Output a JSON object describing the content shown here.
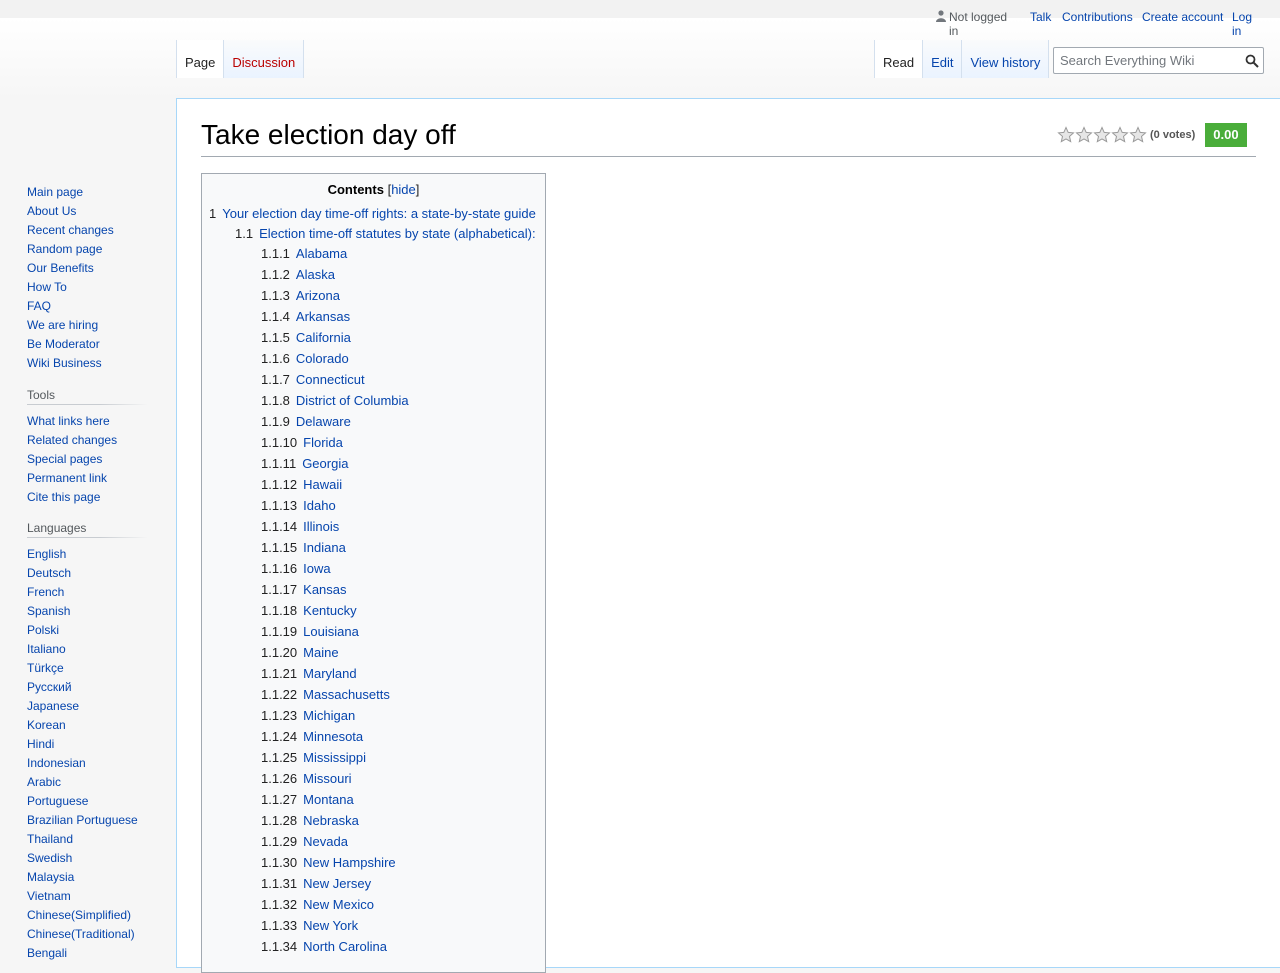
{
  "personal": {
    "user": "Not logged in",
    "talk": "Talk",
    "contributions": "Contributions",
    "create_account": "Create account",
    "login": "Log in"
  },
  "tabs": {
    "page": "Page",
    "discussion": "Discussion",
    "read": "Read",
    "edit": "Edit",
    "history": "View history"
  },
  "search": {
    "placeholder": "Search Everything Wiki"
  },
  "sidebar": {
    "navigation": [
      "Main page",
      "About Us",
      "Recent changes",
      "Random page",
      "Our Benefits",
      "How To",
      "FAQ",
      "We are hiring",
      "Be Moderator",
      "Wiki Business"
    ],
    "tools_title": "Tools",
    "tools": [
      "What links here",
      "Related changes",
      "Special pages",
      "Permanent link",
      "Cite this page"
    ],
    "languages_title": "Languages",
    "languages": [
      "English",
      "Deutsch",
      "French",
      "Spanish",
      "Polski",
      "Italiano",
      "Türkçe",
      "Русский",
      "Japanese",
      "Korean",
      "Hindi",
      "Indonesian",
      "Arabic",
      "Portuguese",
      "Brazilian Portuguese",
      "Thailand",
      "Swedish",
      "Malaysia",
      "Vietnam",
      "Chinese(Simplified)",
      "Chinese(Traditional)",
      "Bengali"
    ]
  },
  "page": {
    "title": "Take election day off",
    "votes": "(0 votes)",
    "score": "0.00",
    "stars": 5
  },
  "toc": {
    "title": "Contents",
    "toggle": "hide",
    "top": [
      {
        "num": "1",
        "text": "Your election day time-off rights: a state-by-state guide"
      },
      {
        "num": "1.1",
        "text": "Election time-off statutes by state (alphabetical):"
      }
    ],
    "states": [
      {
        "num": "1.1.1",
        "text": "Alabama"
      },
      {
        "num": "1.1.2",
        "text": "Alaska"
      },
      {
        "num": "1.1.3",
        "text": "Arizona"
      },
      {
        "num": "1.1.4",
        "text": "Arkansas"
      },
      {
        "num": "1.1.5",
        "text": "California"
      },
      {
        "num": "1.1.6",
        "text": "Colorado"
      },
      {
        "num": "1.1.7",
        "text": "Connecticut"
      },
      {
        "num": "1.1.8",
        "text": "District of Columbia"
      },
      {
        "num": "1.1.9",
        "text": "Delaware"
      },
      {
        "num": "1.1.10",
        "text": "Florida"
      },
      {
        "num": "1.1.11",
        "text": "Georgia"
      },
      {
        "num": "1.1.12",
        "text": "Hawaii"
      },
      {
        "num": "1.1.13",
        "text": "Idaho"
      },
      {
        "num": "1.1.14",
        "text": "Illinois"
      },
      {
        "num": "1.1.15",
        "text": "Indiana"
      },
      {
        "num": "1.1.16",
        "text": "Iowa"
      },
      {
        "num": "1.1.17",
        "text": "Kansas"
      },
      {
        "num": "1.1.18",
        "text": "Kentucky"
      },
      {
        "num": "1.1.19",
        "text": "Louisiana"
      },
      {
        "num": "1.1.20",
        "text": "Maine"
      },
      {
        "num": "1.1.21",
        "text": "Maryland"
      },
      {
        "num": "1.1.22",
        "text": "Massachusetts"
      },
      {
        "num": "1.1.23",
        "text": "Michigan"
      },
      {
        "num": "1.1.24",
        "text": "Minnesota"
      },
      {
        "num": "1.1.25",
        "text": "Mississippi"
      },
      {
        "num": "1.1.26",
        "text": "Missouri"
      },
      {
        "num": "1.1.27",
        "text": "Montana"
      },
      {
        "num": "1.1.28",
        "text": "Nebraska"
      },
      {
        "num": "1.1.29",
        "text": "Nevada"
      },
      {
        "num": "1.1.30",
        "text": "New Hampshire"
      },
      {
        "num": "1.1.31",
        "text": "New Jersey"
      },
      {
        "num": "1.1.32",
        "text": "New Mexico"
      },
      {
        "num": "1.1.33",
        "text": "New York"
      },
      {
        "num": "1.1.34",
        "text": "North Carolina"
      }
    ]
  },
  "colors": {
    "link": "#0645ad",
    "new_link": "#ba0000",
    "score_bg": "#4aad3a",
    "content_border": "#a7d7f9"
  }
}
